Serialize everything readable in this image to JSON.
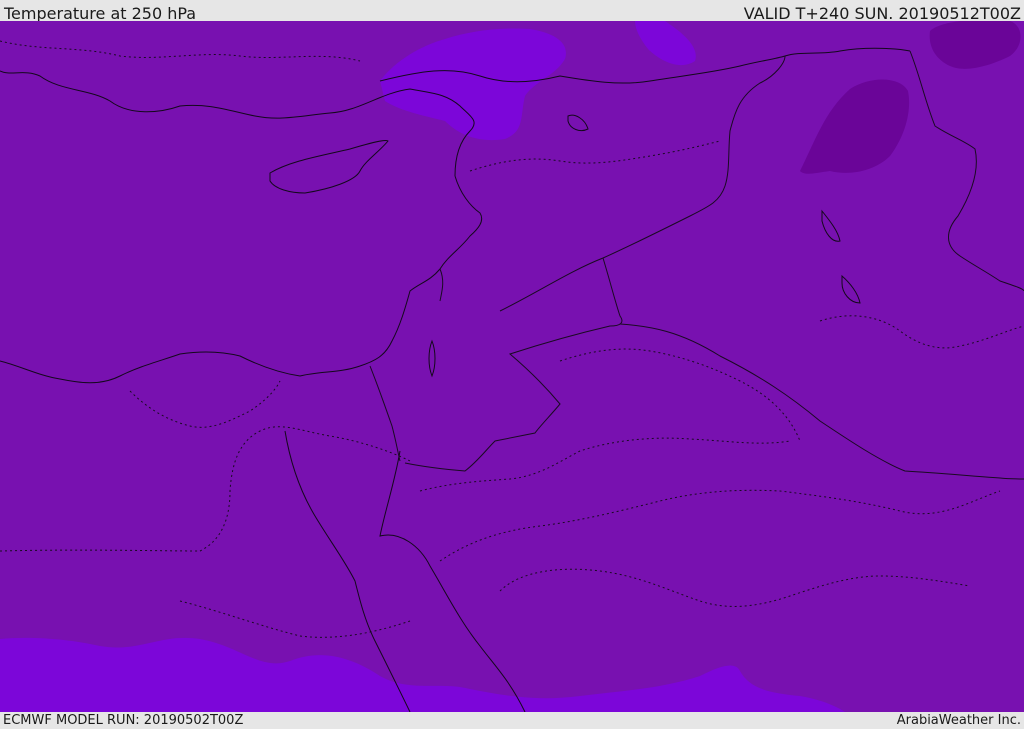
{
  "header": {
    "title": "Temperature at 250 hPa",
    "valid": "VALID T+240 SUN. 20190512T00Z"
  },
  "footer": {
    "model_run": "ECMWF MODEL RUN: 20190502T00Z",
    "credit": "ArabiaWeather Inc."
  },
  "colors": {
    "base_fill": "#7811b0",
    "light_fill": "#7c06d9",
    "dark_fill": "#6a0598",
    "background": "#e6e6e6",
    "lines": "#1a0a22"
  }
}
